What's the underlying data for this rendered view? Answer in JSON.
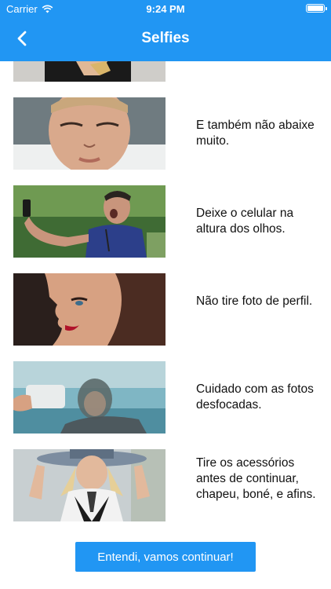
{
  "status": {
    "carrier": "Carrier",
    "time": "9:24 PM",
    "battery_level": 1.0
  },
  "nav": {
    "title": "Selfies",
    "back_icon": "chevron-left-icon"
  },
  "tips": [
    {
      "caption": "E também não abaixe muito."
    },
    {
      "caption": "Deixe o celular na altura dos olhos."
    },
    {
      "caption": "Não tire foto de perfil."
    },
    {
      "caption": "Cuidado com as fotos desfocadas."
    },
    {
      "caption": "Tire os acessórios antes de continuar, chapeu, boné, e afins."
    }
  ],
  "cta": {
    "label": "Entendi, vamos continuar!"
  },
  "colors": {
    "primary": "#2196f3",
    "background": "#ffffff",
    "text": "#111111"
  }
}
